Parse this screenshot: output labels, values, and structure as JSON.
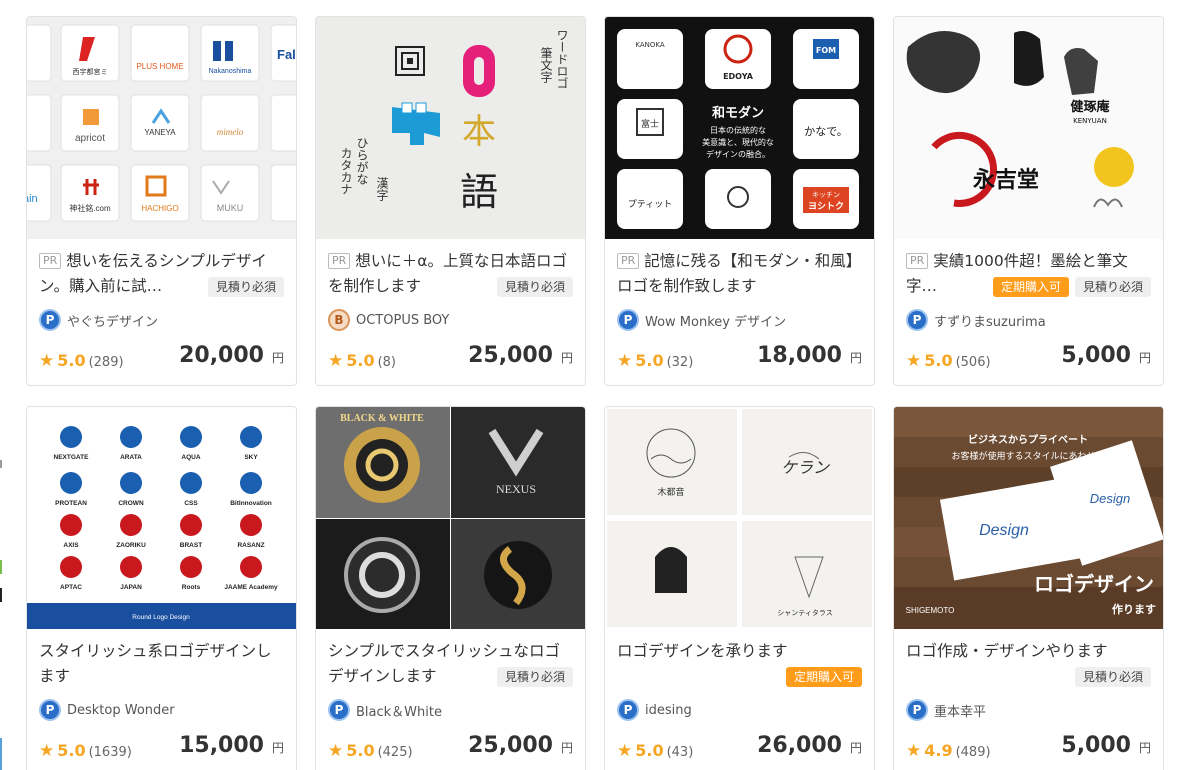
{
  "currency": "円",
  "pr_label": "PR",
  "colors": {
    "star": "#f5a623",
    "subscribe_tag": "#ff9c1a",
    "estimate_tag": "#efefef",
    "pro_badge": "#2a6ec8"
  },
  "cards": [
    {
      "title": "想いを伝えるシンプルデザイン。購入前に試…",
      "pr": true,
      "tags": {
        "estimate": "見積り必須"
      },
      "seller": {
        "name": "やぐちデザイン",
        "badge": "P"
      },
      "rating": {
        "score": "5.0",
        "count": "(289)"
      },
      "price": "20,000",
      "thumb": {
        "texts": [
          "PLUS HOME",
          "Nakanoshima",
          "apricot",
          "YANEYA",
          "mimelo",
          "神社銘.com",
          "HACHIGO",
          "MUKU",
          "Fal",
          "ain"
        ]
      }
    },
    {
      "title": "想いに＋α。上質な日本語ロゴを制作します",
      "pr": true,
      "tags": {
        "estimate": "見積り必須"
      },
      "seller": {
        "name": "OCTOPUS BOY",
        "badge": "B"
      },
      "rating": {
        "score": "5.0",
        "count": "(8)"
      },
      "price": "25,000",
      "thumb": {
        "texts": [
          "ワードロゴ",
          "筆文字",
          "ひらがな",
          "カタカナ",
          "漢字",
          "日",
          "本",
          "語"
        ]
      }
    },
    {
      "title": "記憶に残る【和モダン・和風】ロゴを制作致します",
      "pr": true,
      "tags": {},
      "seller": {
        "name": "Wow Monkey デザイン",
        "badge": "P"
      },
      "rating": {
        "score": "5.0",
        "count": "(32)"
      },
      "price": "18,000",
      "thumb": {
        "texts": [
          "KANOKA",
          "EDOYA",
          "FOM",
          "富士",
          "和モダン",
          "日本の伝統的な",
          "美意識と、現代的な",
          "デザインの融合。",
          "かなで。",
          "プティット",
          "キッチン",
          "ヨシトク"
        ]
      }
    },
    {
      "title": "実績1000件超！墨絵と筆文字…",
      "pr": true,
      "tags": {
        "subscribe": "定期購入可",
        "estimate": "見積り必須"
      },
      "seller": {
        "name": "すずりまsuzurima",
        "badge": "P"
      },
      "rating": {
        "score": "5.0",
        "count": "(506)"
      },
      "price": "5,000",
      "thumb": {
        "texts": [
          "健琢庵",
          "KENYUAN",
          "永吉堂"
        ]
      }
    },
    {
      "title": "スタイリッシュ系ロゴデザインします",
      "pr": false,
      "tags": {},
      "seller": {
        "name": "Desktop Wonder",
        "badge": "P"
      },
      "rating": {
        "score": "5.0",
        "count": "(1639)"
      },
      "price": "15,000",
      "thumb": {
        "texts": [
          "NEXTGATE",
          "ARATA",
          "AQUA",
          "SKY",
          "PROTEAN",
          "CROWN",
          "CSS",
          "BitInnovation",
          "AXIS",
          "ZAORIKU",
          "BRAST",
          "RASANZ",
          "APTAC",
          "JAPAN",
          "Roots",
          "JAAME Academy",
          "Round Logo Design"
        ]
      }
    },
    {
      "title": "シンプルでスタイリッシュなロゴデザインします",
      "pr": false,
      "tags": {
        "estimate": "見積り必須"
      },
      "seller": {
        "name": "Black＆White",
        "badge": "P"
      },
      "rating": {
        "score": "5.0",
        "count": "(425)"
      },
      "price": "25,000",
      "thumb": {
        "texts": [
          "BLACK & WHITE",
          "NEXUS"
        ]
      }
    },
    {
      "title": "ロゴデザインを承ります",
      "pr": false,
      "tags": {
        "subscribe": "定期購入可"
      },
      "seller": {
        "name": "idesing",
        "badge": "P"
      },
      "rating": {
        "score": "5.0",
        "count": "(43)"
      },
      "price": "26,000",
      "thumb": {
        "texts": [
          "木都音",
          "ケラン",
          "シャンティタラス"
        ]
      }
    },
    {
      "title": "ロゴ作成・デザインやります",
      "pr": false,
      "tags": {
        "estimate": "見積り必須"
      },
      "seller": {
        "name": "重本幸平",
        "badge": "P"
      },
      "rating": {
        "score": "4.9",
        "count": "(489)"
      },
      "price": "5,000",
      "thumb": {
        "texts": [
          "ビジネスからプライベート",
          "お客様が使用するスタイルにあわせて",
          "Design",
          "Design",
          "ロゴデザイン",
          "作ります",
          "SHIGEMOTO"
        ]
      }
    }
  ]
}
